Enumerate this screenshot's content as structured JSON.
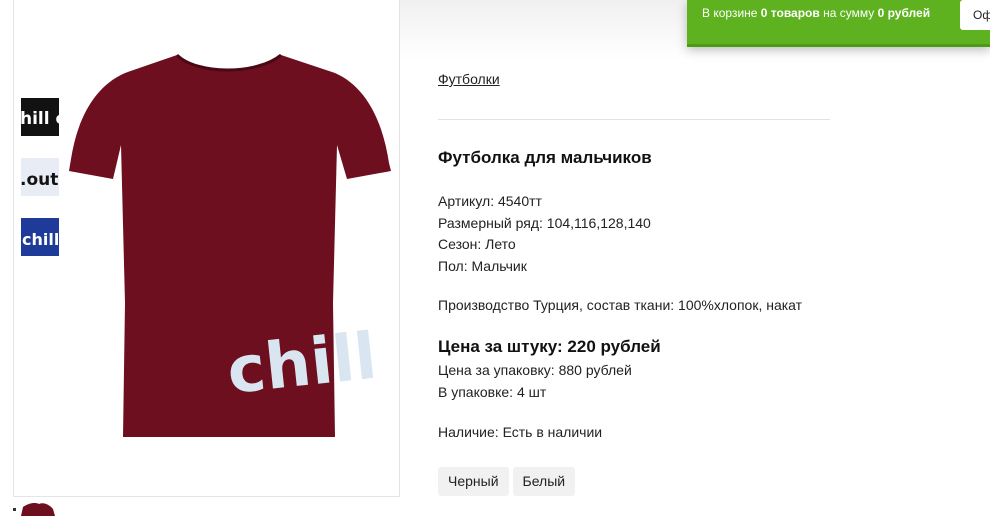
{
  "cart": {
    "prefix": "В корзине ",
    "count": "0 товаров",
    "middle": " на сумму ",
    "sum": "0 рублей",
    "button_label": "Оформить"
  },
  "breadcrumb": {
    "category": "Футболки"
  },
  "product": {
    "title": "Футболка для мальчиков",
    "article": "Артикул: 4540тт",
    "sizes": "Размерный ряд: 104,116,128,140",
    "season": "Сезон: Лето",
    "gender": "Пол: Мальчик",
    "production": "Производство Турция, состав ткани: 100%хлопок, накат",
    "price_per_item": "Цена за штуку: 220 рублей",
    "price_per_pack": "Цена за упаковку: 880 рублей",
    "pack_size": "В упаковке: 4 шт",
    "availability": "Наличие: Есть в наличии",
    "print_text": "chill"
  },
  "thumbnails": [
    {
      "text": "hill c",
      "bg": "#121212",
      "fg": "#ffffff"
    },
    {
      "text": ".out",
      "bg": "#e8edf5",
      "fg": "#121212"
    },
    {
      "text": "chill",
      "bg": "#1f3b9a",
      "fg": "#ffffff"
    }
  ],
  "colors": {
    "shirt": "#6d0f1e",
    "print": "#d9e6f2",
    "cart_bg": "#5fb21f"
  },
  "color_options": [
    "Черный",
    "Белый"
  ]
}
